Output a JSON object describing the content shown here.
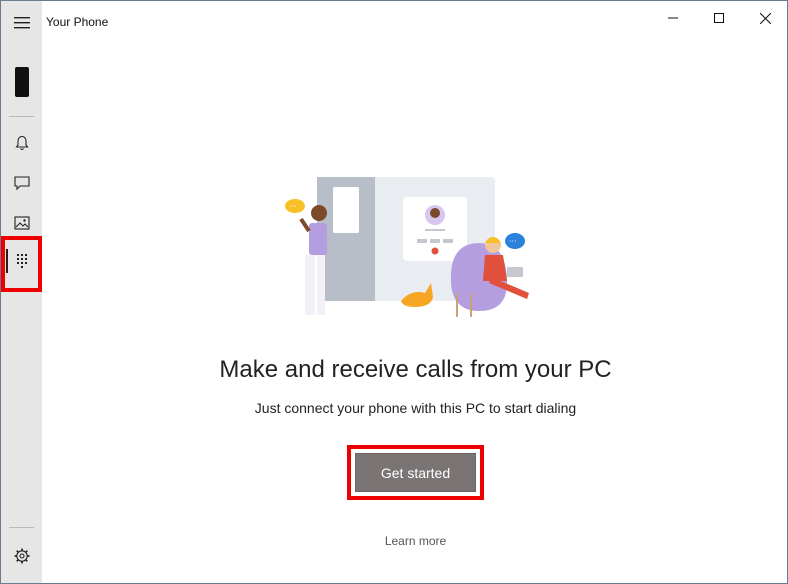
{
  "app": {
    "title": "Your Phone"
  },
  "window_controls": {
    "minimize": "minimize",
    "maximize": "maximize",
    "close": "close"
  },
  "sidebar": {
    "items": [
      {
        "name": "hamburger-icon"
      },
      {
        "name": "phone-icon"
      },
      {
        "name": "notifications-icon"
      },
      {
        "name": "messages-icon"
      },
      {
        "name": "photos-icon"
      },
      {
        "name": "dialpad-icon",
        "active": true
      },
      {
        "name": "settings-icon"
      }
    ]
  },
  "main": {
    "headline": "Make and receive calls from your PC",
    "subline": "Just connect your phone with this PC to start dialing",
    "cta_label": "Get started",
    "learn_more": "Learn more"
  },
  "colors": {
    "sidebar_bg": "#e6e6e6",
    "button_bg": "#7a7574",
    "highlight": "#ee0000",
    "accent_purple": "#b49ee0",
    "accent_orange": "#f6a623",
    "accent_blue": "#2a82da"
  }
}
